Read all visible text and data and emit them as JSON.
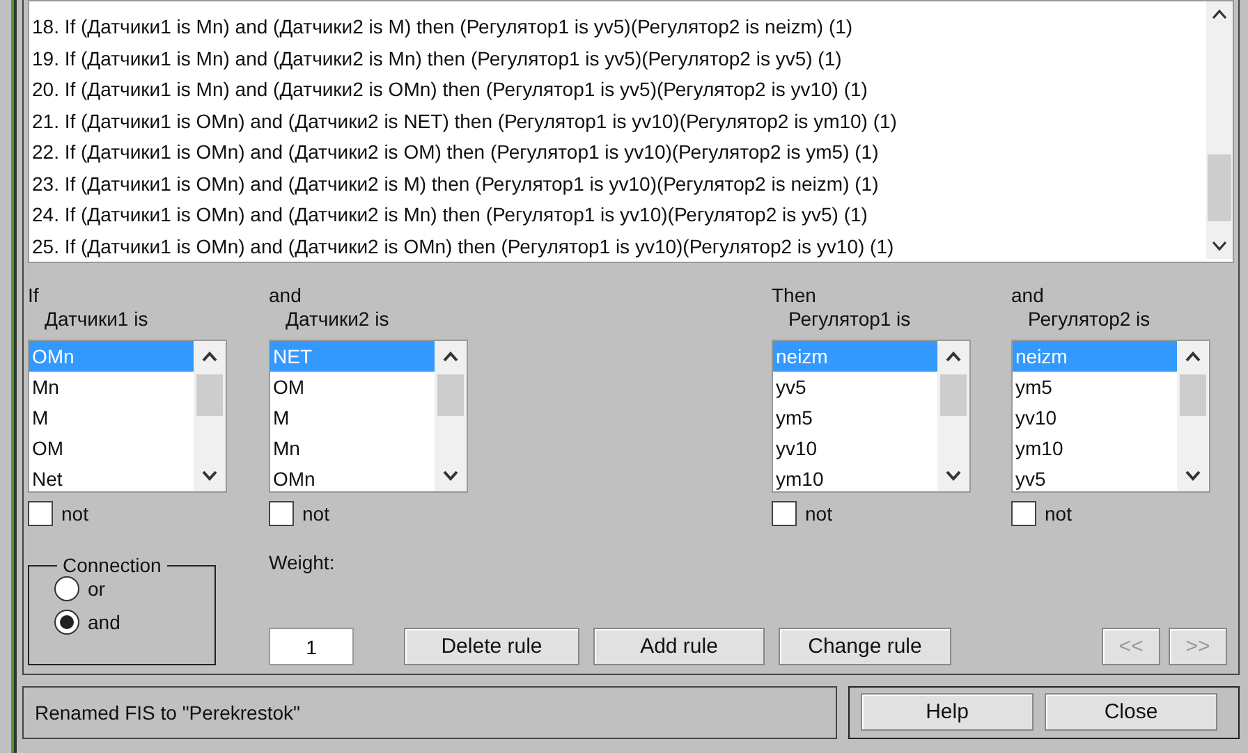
{
  "rules": [
    "18. If (Датчики1 is Mn) and (Датчики2 is M) then (Регулятор1 is yv5)(Регулятор2 is neizm) (1)",
    "19. If (Датчики1 is Mn) and (Датчики2 is Mn) then (Регулятор1 is yv5)(Регулятор2 is yv5) (1)",
    "20. If (Датчики1 is Mn) and (Датчики2 is OMn) then (Регулятор1 is yv5)(Регулятор2 is yv10) (1)",
    "21. If (Датчики1 is OMn) and (Датчики2 is NET) then (Регулятор1 is yv10)(Регулятор2 is ym10) (1)",
    "22. If (Датчики1 is OMn) and (Датчики2 is OM) then (Регулятор1 is yv10)(Регулятор2 is ym5) (1)",
    "23. If (Датчики1 is OMn) and (Датчики2 is M) then (Регулятор1 is yv10)(Регулятор2 is neizm) (1)",
    "24. If (Датчики1 is OMn) and (Датчики2 is Mn) then (Регулятор1 is yv10)(Регулятор2 is yv5) (1)",
    "25. If (Датчики1 is OMn) and (Датчики2 is OMn) then (Регулятор1 is yv10)(Регулятор2 is yv10) (1)"
  ],
  "selectors": [
    {
      "header": "If",
      "label": "Датчики1 is",
      "items": [
        {
          "label": "OMn",
          "selected": true
        },
        {
          "label": "Mn",
          "selected": false
        },
        {
          "label": "M",
          "selected": false
        },
        {
          "label": "OM",
          "selected": false
        },
        {
          "label": "Net",
          "selected": false
        }
      ],
      "not_label": "not",
      "not_checked": false
    },
    {
      "header": "and",
      "label": "Датчики2 is",
      "items": [
        {
          "label": "NET",
          "selected": true
        },
        {
          "label": "OM",
          "selected": false
        },
        {
          "label": "M",
          "selected": false
        },
        {
          "label": "Mn",
          "selected": false
        },
        {
          "label": "OMn",
          "selected": false
        }
      ],
      "not_label": "not",
      "not_checked": false
    },
    {
      "header": "Then",
      "label": "Регулятор1 is",
      "items": [
        {
          "label": "neizm",
          "selected": true
        },
        {
          "label": "yv5",
          "selected": false
        },
        {
          "label": "ym5",
          "selected": false
        },
        {
          "label": "yv10",
          "selected": false
        },
        {
          "label": "ym10",
          "selected": false
        }
      ],
      "not_label": "not",
      "not_checked": false
    },
    {
      "header": "and",
      "label": "Регулятор2 is",
      "items": [
        {
          "label": "neizm",
          "selected": true
        },
        {
          "label": "ym5",
          "selected": false
        },
        {
          "label": "yv10",
          "selected": false
        },
        {
          "label": "ym10",
          "selected": false
        },
        {
          "label": "yv5",
          "selected": false
        }
      ],
      "not_label": "not",
      "not_checked": false
    }
  ],
  "connection": {
    "title": "Connection",
    "options": [
      {
        "label": "or",
        "selected": false
      },
      {
        "label": "and",
        "selected": true
      }
    ]
  },
  "weight": {
    "label": "Weight:",
    "value": "1"
  },
  "rule_buttons": [
    {
      "label": "Delete rule",
      "disabled": false
    },
    {
      "label": "Add rule",
      "disabled": false
    },
    {
      "label": "Change rule",
      "disabled": false
    }
  ],
  "nav_buttons": [
    {
      "label": "<<",
      "disabled": true
    },
    {
      "label": ">>",
      "disabled": true
    }
  ],
  "status": "Renamed FIS to \"Perekrestok\"",
  "footer_buttons": [
    {
      "label": "Help"
    },
    {
      "label": "Close"
    }
  ]
}
